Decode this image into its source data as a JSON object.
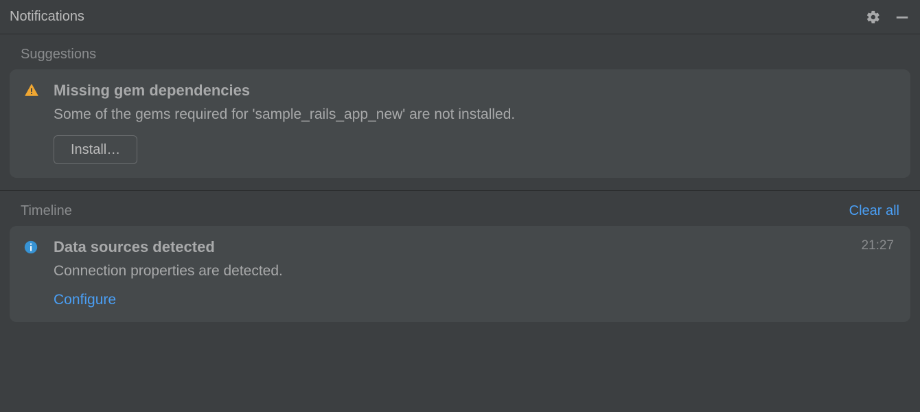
{
  "header": {
    "title": "Notifications"
  },
  "sections": {
    "suggestions": {
      "label": "Suggestions",
      "card": {
        "title": "Missing gem dependencies",
        "body": "Some of the gems required for 'sample_rails_app_new' are not installed.",
        "action_label": "Install…"
      }
    },
    "timeline": {
      "label": "Timeline",
      "clear_label": "Clear all",
      "card": {
        "title": "Data sources detected",
        "body": "Connection properties are detected.",
        "link_label": "Configure",
        "timestamp": "21:27"
      }
    }
  }
}
